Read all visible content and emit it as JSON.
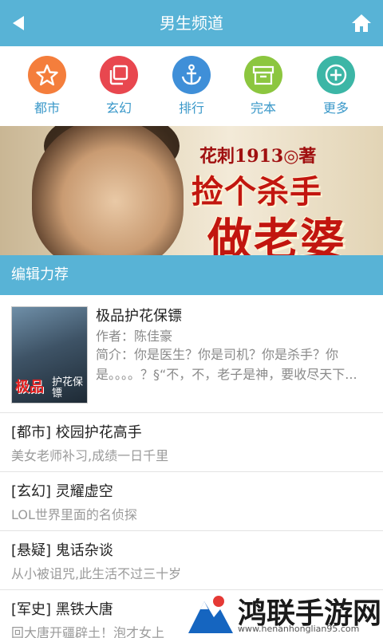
{
  "header": {
    "title": "男生频道",
    "back_icon": "back-arrow-icon",
    "home_icon": "home-icon"
  },
  "categories": [
    {
      "label": "都市",
      "icon": "star-icon",
      "color": "#f47e3c"
    },
    {
      "label": "玄幻",
      "icon": "layers-icon",
      "color": "#e8474f"
    },
    {
      "label": "排行",
      "icon": "anchor-icon",
      "color": "#3f8fd8"
    },
    {
      "label": "完本",
      "icon": "archive-box-icon",
      "color": "#8cc63f"
    },
    {
      "label": "更多",
      "icon": "plus-icon",
      "color": "#3cb6a6"
    }
  ],
  "banner": {
    "author": "花刺1913◎著",
    "line1": "捡个杀手",
    "line2": "做老婆"
  },
  "section": {
    "title": "编辑力荐"
  },
  "featured": {
    "title": "极品护花保镖",
    "author": "作者：陈佳豪",
    "desc": "简介：你是医生？你是司机？你是杀手？你是。。。。？§“不，不，老子是神，要收尽天下...",
    "cover_title": "极品",
    "cover_sub": "护花保镖"
  },
  "items": [
    {
      "title": "[都市] 校园护花高手",
      "desc": "美女老师补习,成绩一日千里"
    },
    {
      "title": "[玄幻] 灵耀虚空",
      "desc": "LOL世界里面的名侦探"
    },
    {
      "title": "[悬疑] 鬼话杂谈",
      "desc": "从小被诅咒,此生活不过三十岁"
    },
    {
      "title": "[军史] 黑铁大唐",
      "desc": "回大唐开疆辟土！泡才女上"
    }
  ],
  "watermark": {
    "text": "鸿联手游网",
    "url": "www.henanhonglian95.com"
  },
  "colors": {
    "accent": "#58b3d6",
    "title_red": "#c2160f"
  }
}
